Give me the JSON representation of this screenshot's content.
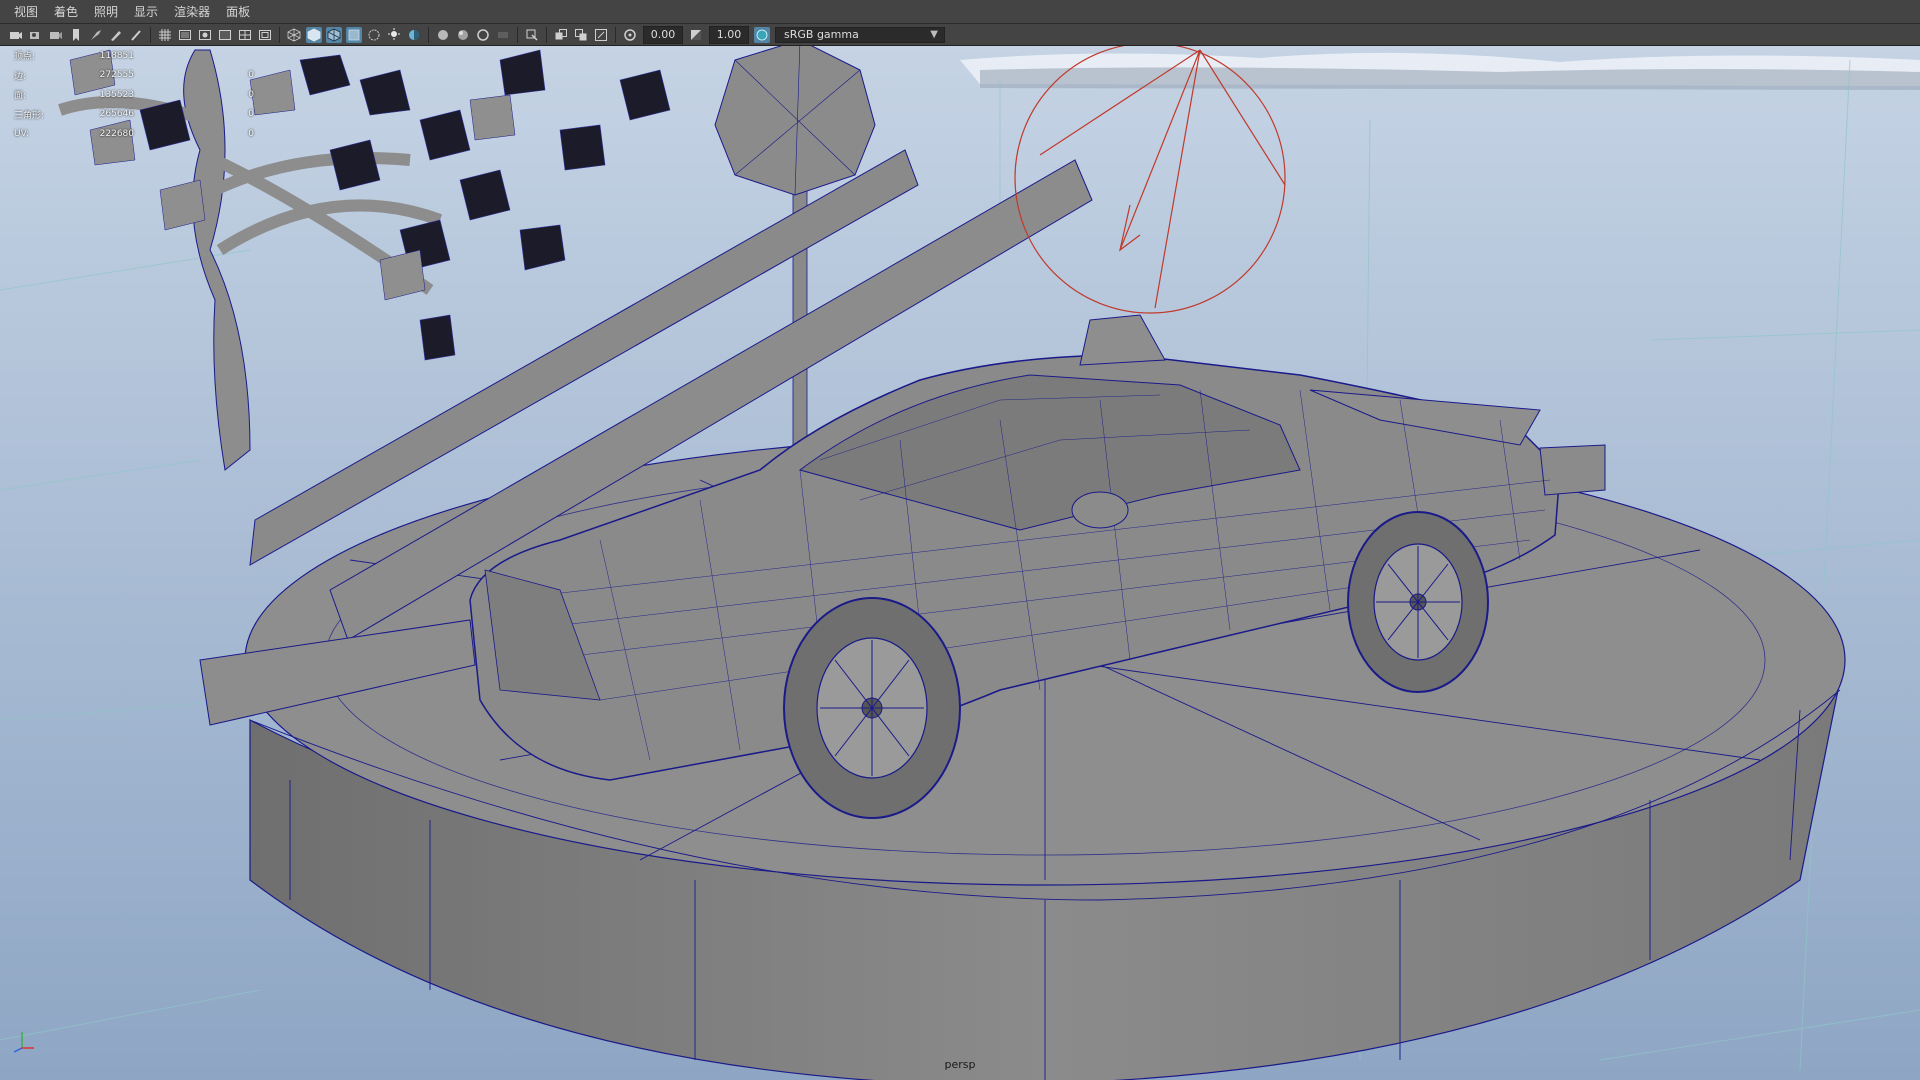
{
  "menu": {
    "items": [
      "视图",
      "着色",
      "照明",
      "显示",
      "渲染器",
      "面板"
    ]
  },
  "toolbar": {
    "exposure_value": "0.00",
    "gamma_value": "1.00",
    "colorspace": "sRGB gamma",
    "icons": [
      "select-camera",
      "camera-attributes",
      "bookmarks",
      "image-plane",
      "2d-pan-zoom",
      "grease-pencil",
      "grid",
      "film-gate",
      "resolution-gate",
      "gate-mask",
      "field-chart",
      "safe-action",
      "wireframe",
      "smooth-shade",
      "wireframe-on-shaded",
      "xray",
      "use-default-material",
      "shadows",
      "screen-space-ambient-occlusion",
      "motion-blur",
      "multisample-antialiasing",
      "depth-of-field",
      "isolate-select",
      "xray-active-components",
      "xray-joints",
      "exposure",
      "gamma",
      "color-management"
    ],
    "accent": "#5285a6"
  },
  "hud": {
    "rows": [
      {
        "label": "顶点:",
        "value": "118851",
        "extra": ""
      },
      {
        "label": "边:",
        "value": "272555",
        "extra": "0"
      },
      {
        "label": "面:",
        "value": "135523",
        "extra": "0"
      },
      {
        "label": "三角形:",
        "value": "265646",
        "extra": "0"
      },
      {
        "label": "UV:",
        "value": "222680",
        "extra": "0"
      }
    ]
  },
  "viewport": {
    "camera": "persp",
    "sky_top": "#bac9de",
    "sky_bottom": "#97adc9",
    "mesh_fill": "#8b8b8b",
    "wire_color": "#1a1a8a",
    "light_color": "#c0392b"
  }
}
